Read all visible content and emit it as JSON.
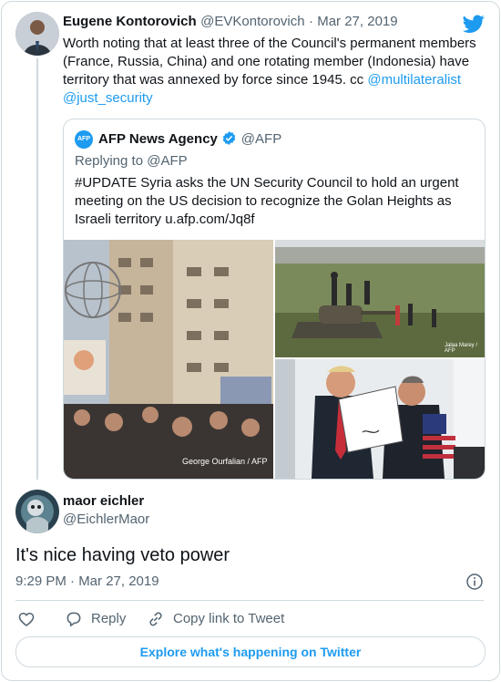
{
  "original_tweet": {
    "author_name": "Eugene Kontorovich",
    "author_handle": "@EVKontorovich",
    "date": "· Mar 27, 2019",
    "text_main": "Worth noting that at least three of the Council's permanent members (France, Russia, China) and one rotating member (Indonesia) have territory that was annexed by force since 1945.  cc ",
    "mention_1": "@multilateralist",
    "mention_2": "@just_security"
  },
  "quoted_tweet": {
    "avatar_text": "AFP",
    "author_name": "AFP News Agency",
    "author_handle": "@AFP",
    "replying_to_label": "Replying to ",
    "replying_to_handle": "@AFP",
    "text": "#UPDATE Syria asks the UN Security Council to hold an urgent meeting on the US decision to recognize the Golan Heights as Israeli territory ",
    "url": "u.afp.com/Jq8f",
    "photo_credit_1": "George Ourfalian / AFP",
    "photo_credit_2": "Jalaa Marey / AFP"
  },
  "reply_tweet": {
    "author_name": "maor eichler",
    "author_handle": "@EichlerMaor",
    "text": "It's nice having veto power",
    "timestamp": "9:29 PM · Mar 27, 2019"
  },
  "actions": {
    "reply_label": "Reply",
    "copy_link_label": "Copy link to Tweet"
  },
  "explore_label": "Explore what's happening on Twitter",
  "colors": {
    "accent": "#1d9bf0",
    "verified": "#1d9bf0",
    "border": "#cfd9de",
    "muted": "#536471"
  },
  "icons": [
    "twitter-bird-icon",
    "verified-badge-icon",
    "info-icon",
    "heart-icon",
    "reply-icon",
    "link-icon"
  ]
}
